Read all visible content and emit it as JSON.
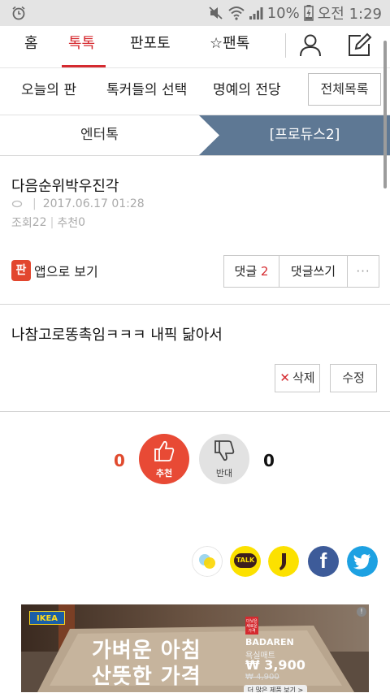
{
  "status_bar": {
    "battery_percent": "10%",
    "time": "오전 1:29"
  },
  "top_nav": {
    "tabs": [
      {
        "label": "홈"
      },
      {
        "label": "톡톡"
      },
      {
        "label": "판포토"
      },
      {
        "label": "☆팬톡"
      }
    ],
    "active_tab": "톡톡",
    "icons": [
      "profile-icon",
      "write-icon"
    ]
  },
  "sub_nav": {
    "items": [
      {
        "label": "오늘의 판"
      },
      {
        "label": "톡커들의 선택"
      },
      {
        "label": "명예의 전당"
      }
    ],
    "all_button": "전체목록"
  },
  "category": {
    "left": "엔터톡",
    "right": "[프로듀스2]"
  },
  "post": {
    "title": "다음순위박우진각",
    "meta_sep": "|",
    "date": "2017.06.17 01:28",
    "views_label": "조회",
    "views": "22",
    "recommend_label": "추천",
    "recommend": "0",
    "body": "나참고로똥촉임ㅋㅋㅋ 내픽 닮아서"
  },
  "actions": {
    "app_icon_text": "판",
    "app_view": "앱으로 보기",
    "comments_label": "댓글",
    "comments_count": "2",
    "write_comment": "댓글쓰기",
    "more": "···",
    "delete": "삭제",
    "edit": "수정"
  },
  "votes": {
    "up_count": "0",
    "up_label": "추천",
    "down_label": "반대",
    "down_count": "0"
  },
  "share": {
    "icons": [
      "kakaostory-icon",
      "kakaotalk-icon",
      "kakao-channel-icon",
      "facebook-icon",
      "twitter-icon"
    ],
    "kakaotalk_text": "TALK",
    "facebook_text": "f"
  },
  "ad": {
    "logo": "IKEA",
    "headline_line1": "가벼운 아침",
    "headline_line2": "산뜻한 가격",
    "tag_text": "더낮은 새로운 가격",
    "brand": "BADAREN",
    "product": "욕실매트",
    "price": "₩ 3,900",
    "old_price": "₩ 4,900",
    "more_button": "더 많은 제품 보기 >",
    "info": "!"
  },
  "colors": {
    "accent": "#d52a2f",
    "category_active_bg": "#5e7894",
    "recommend": "#e84a35"
  }
}
